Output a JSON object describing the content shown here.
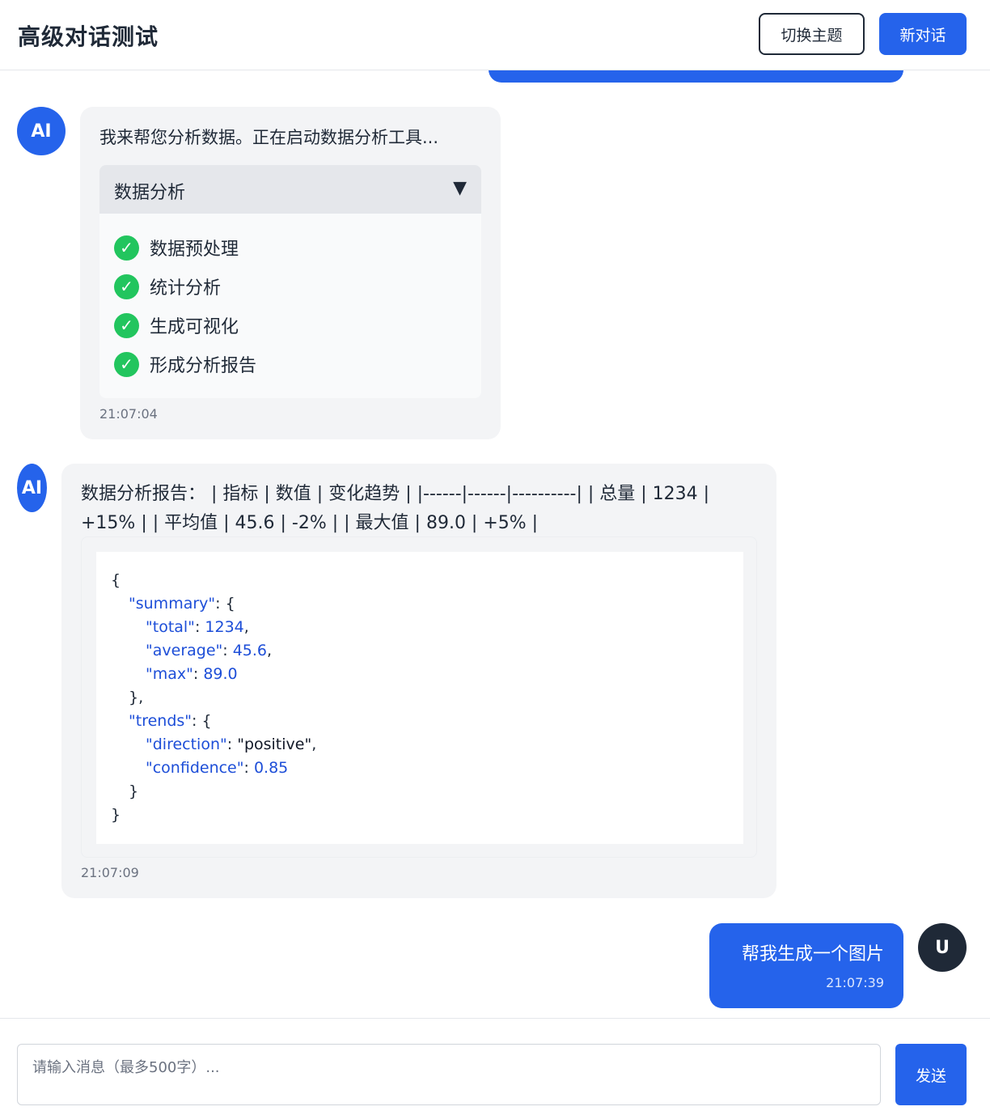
{
  "header": {
    "title": "高级对话测试",
    "theme_button": "切换主题",
    "new_chat_button": "新对话"
  },
  "messages": [
    {
      "role": "ai",
      "avatar": "AI",
      "text": "我来帮您分析数据。正在启动数据分析工具...",
      "tool": {
        "name": "数据分析",
        "expand_icon": "triangle-down",
        "steps": [
          "数据预处理",
          "统计分析",
          "生成可视化",
          "形成分析报告"
        ],
        "step_status": "completed"
      },
      "time": "21:07:04"
    },
    {
      "role": "ai",
      "avatar": "AI",
      "text_line1": "数据分析报告： | 指标 | 数值 | 变化趋势 | |------|------|----------| | 总量 | 1234 |",
      "text_line2": "+15% | | 平均值 | 45.6 | -2% | | 最大值 | 89.0 | +5% |",
      "code": {
        "open": "{",
        "summary_key": "\"summary\"",
        "total_key": "\"total\"",
        "total_val": "1234",
        "average_key": "\"average\"",
        "average_val": "45.6",
        "max_key": "\"max\"",
        "max_val": "89.0",
        "close_summary": "},",
        "trends_key": "\"trends\"",
        "direction_key": "\"direction\"",
        "direction_val": "\"positive\"",
        "confidence_key": "\"confidence\"",
        "confidence_val": "0.85",
        "close_trends": "}",
        "close": "}"
      },
      "time": "21:07:09"
    },
    {
      "role": "user",
      "avatar": "U",
      "text": "帮我生成一个图片",
      "time": "21:07:39"
    }
  ],
  "composer": {
    "placeholder": "请输入消息（最多500字）...",
    "send_button": "发送"
  },
  "colors": {
    "accent": "#2563eb",
    "ai_bubble": "#f3f4f6",
    "user_avatar": "#1f2937",
    "success": "#22c55e"
  }
}
